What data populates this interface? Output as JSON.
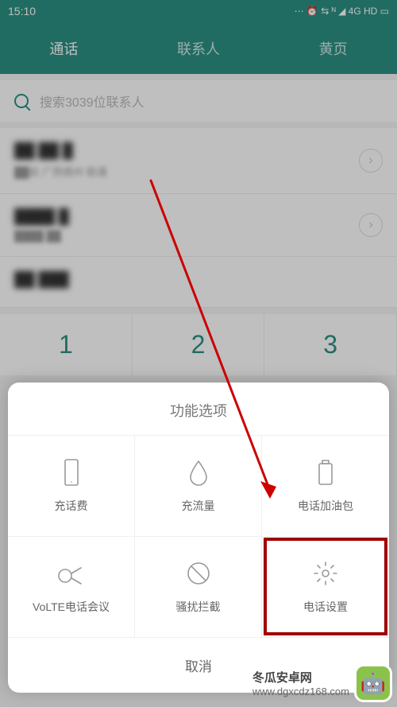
{
  "status": {
    "time": "15:10",
    "indicators": "⋯ ⏰ ⇆ ᴺ ◢ 4G HD ▭"
  },
  "header": {
    "tabs": [
      {
        "label": "通话",
        "active": true
      },
      {
        "label": "联系人",
        "active": false
      },
      {
        "label": "黄页",
        "active": false
      }
    ]
  },
  "search": {
    "placeholder": "搜索3039位联系人"
  },
  "calls": [
    {
      "name": "██ ██ █",
      "meta": "██前 广西梧州 联通"
    },
    {
      "name": "████ █",
      "meta": "████ ██"
    },
    {
      "name": "██ ███",
      "meta": ""
    }
  ],
  "dialpad": {
    "keys": [
      "1",
      "2",
      "3"
    ]
  },
  "sheet": {
    "title": "功能选项",
    "items": [
      {
        "label": "充话费",
        "icon": "phone-card-icon"
      },
      {
        "label": "充流量",
        "icon": "drop-icon"
      },
      {
        "label": "电话加油包",
        "icon": "battery-icon"
      },
      {
        "label": "VoLTE电话会议",
        "icon": "volte-icon"
      },
      {
        "label": "骚扰拦截",
        "icon": "block-icon"
      },
      {
        "label": "电话设置",
        "icon": "gear-icon",
        "highlighted": true
      }
    ],
    "cancel": "取消"
  },
  "watermark": {
    "title": "冬瓜安卓网",
    "url": "www.dgxcdz168.com"
  }
}
